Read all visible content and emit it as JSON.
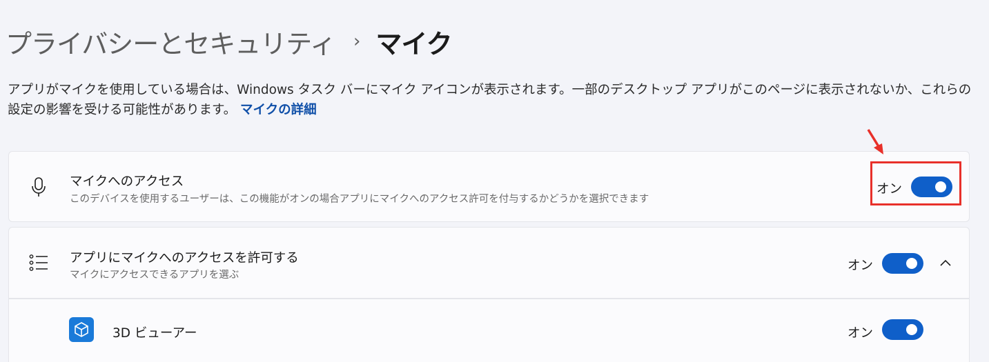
{
  "breadcrumb": {
    "parent": "プライバシーとセキュリティ",
    "separator": "›",
    "current": "マイク"
  },
  "description": {
    "text": "アプリがマイクを使用している場合は、Windows タスク バーにマイク アイコンが表示されます。一部のデスクトップ アプリがこのページに表示されないか、これらの設定の影響を受ける可能性があります。",
    "link": "マイクの詳細"
  },
  "mic_access": {
    "icon": "microphone-icon",
    "title": "マイクへのアクセス",
    "subtitle": "このデバイスを使用するユーザーは、この機能がオンの場合アプリにマイクへのアクセス許可を付与するかどうかを選択できます",
    "state_label": "オン",
    "enabled": true
  },
  "app_access": {
    "icon": "list-icon",
    "title": "アプリにマイクへのアクセスを許可する",
    "subtitle": "マイクにアクセスできるアプリを選ぶ",
    "state_label": "オン",
    "enabled": true,
    "expand_icon": "chevron-up-icon"
  },
  "apps": [
    {
      "icon": "3d-viewer-icon",
      "name": "3D ビューアー",
      "state_label": "オン",
      "enabled": true
    }
  ],
  "annotation": {
    "highlight_color": "#e8302a"
  },
  "colors": {
    "accent": "#0f5fc9",
    "link": "#0f4fa8",
    "background": "#f3f4f9"
  }
}
